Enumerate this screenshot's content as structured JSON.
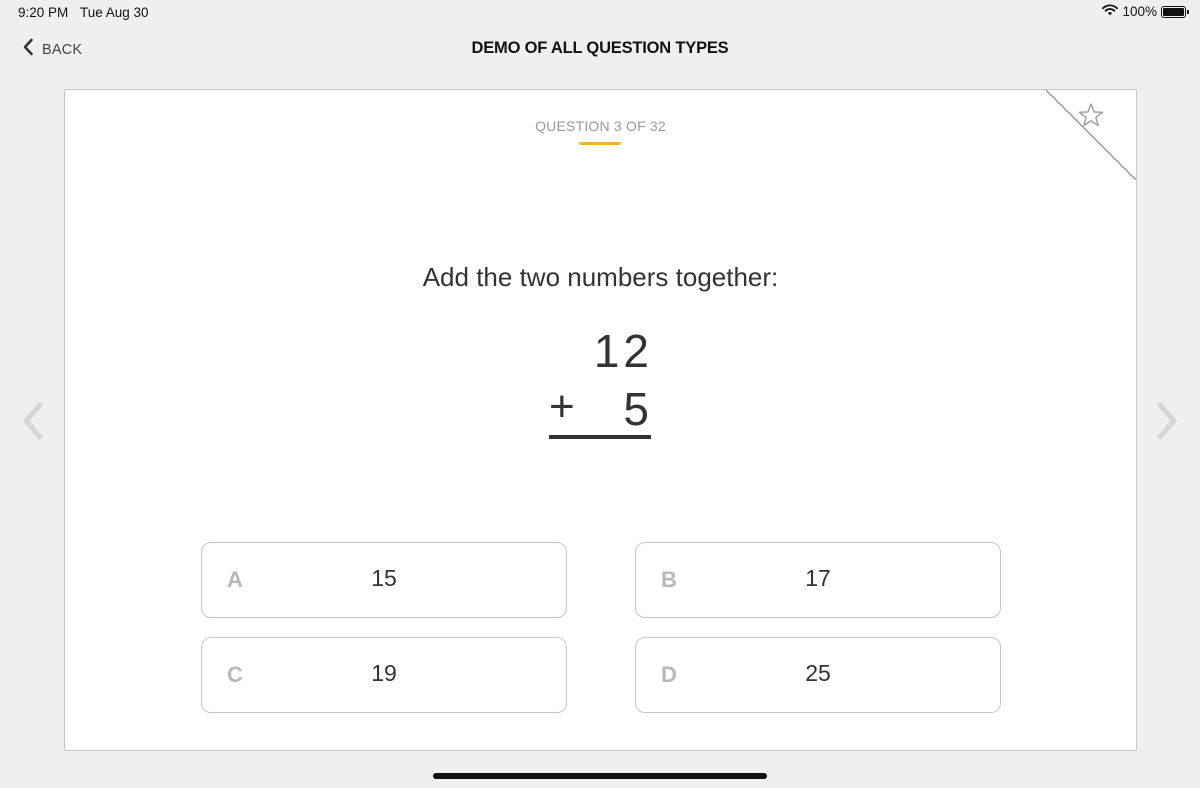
{
  "status_bar": {
    "time": "9:20 PM",
    "date": "Tue Aug 30",
    "battery_percent": "100%",
    "battery_level": 1.0,
    "icons": [
      "wifi-icon",
      "battery-icon"
    ]
  },
  "nav": {
    "back_label": "BACK",
    "back_icon": "chevron-left-icon",
    "title": "DEMO OF ALL QUESTION TYPES"
  },
  "question": {
    "counter": "QUESTION 3 OF 32",
    "prompt": "Add the two numbers together:",
    "math": {
      "top": "12",
      "operator": "+",
      "bottom": "5"
    },
    "bookmark_icon": "star-outline-icon"
  },
  "answers": [
    {
      "letter": "A",
      "value": "15"
    },
    {
      "letter": "B",
      "value": "17"
    },
    {
      "letter": "C",
      "value": "19"
    },
    {
      "letter": "D",
      "value": "25"
    }
  ],
  "navigation_arrows": {
    "previous_icon": "chevron-left-icon",
    "next_icon": "chevron-right-icon"
  },
  "colors": {
    "background": "#efefef",
    "card": "#ffffff",
    "accent": "#f2b51f",
    "muted_text": "#9a9a9a",
    "answer_letter": "#b8b8b8"
  }
}
